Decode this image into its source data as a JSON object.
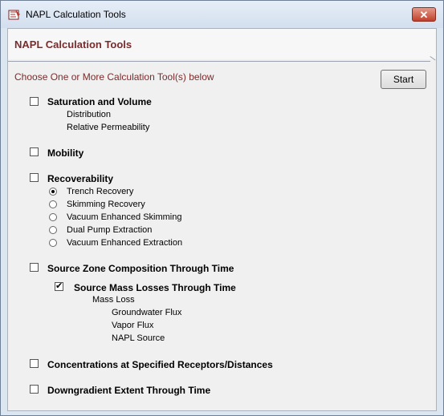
{
  "window": {
    "title": "NAPL Calculation Tools",
    "close_label": "✕"
  },
  "header": {
    "title": "NAPL Calculation Tools"
  },
  "instruction": "Choose One or More Calculation Tool(s) below",
  "start_label": "Start",
  "tools": {
    "saturation": {
      "label": "Saturation and Volume",
      "checked": false,
      "subs": [
        "Distribution",
        "Relative Permeability"
      ]
    },
    "mobility": {
      "label": "Mobility",
      "checked": false
    },
    "recoverability": {
      "label": "Recoverability",
      "checked": false,
      "options": [
        "Trench Recovery",
        "Skimming Recovery",
        "Vacuum Enhanced Skimming",
        "Dual Pump Extraction",
        "Vacuum Enhanced Extraction"
      ],
      "selected": "Trench Recovery"
    },
    "source_zone": {
      "label": "Source Zone Composition Through Time",
      "checked": false
    },
    "source_mass": {
      "label": "Source Mass Losses Through Time",
      "checked": true,
      "mass_loss": "Mass Loss",
      "subs": [
        "Groundwater Flux",
        "Vapor Flux",
        "NAPL Source"
      ]
    },
    "concentrations": {
      "label": "Concentrations at Specified Receptors/Distances",
      "checked": false
    },
    "downgradient": {
      "label": "Downgradient Extent Through Time",
      "checked": false
    }
  }
}
